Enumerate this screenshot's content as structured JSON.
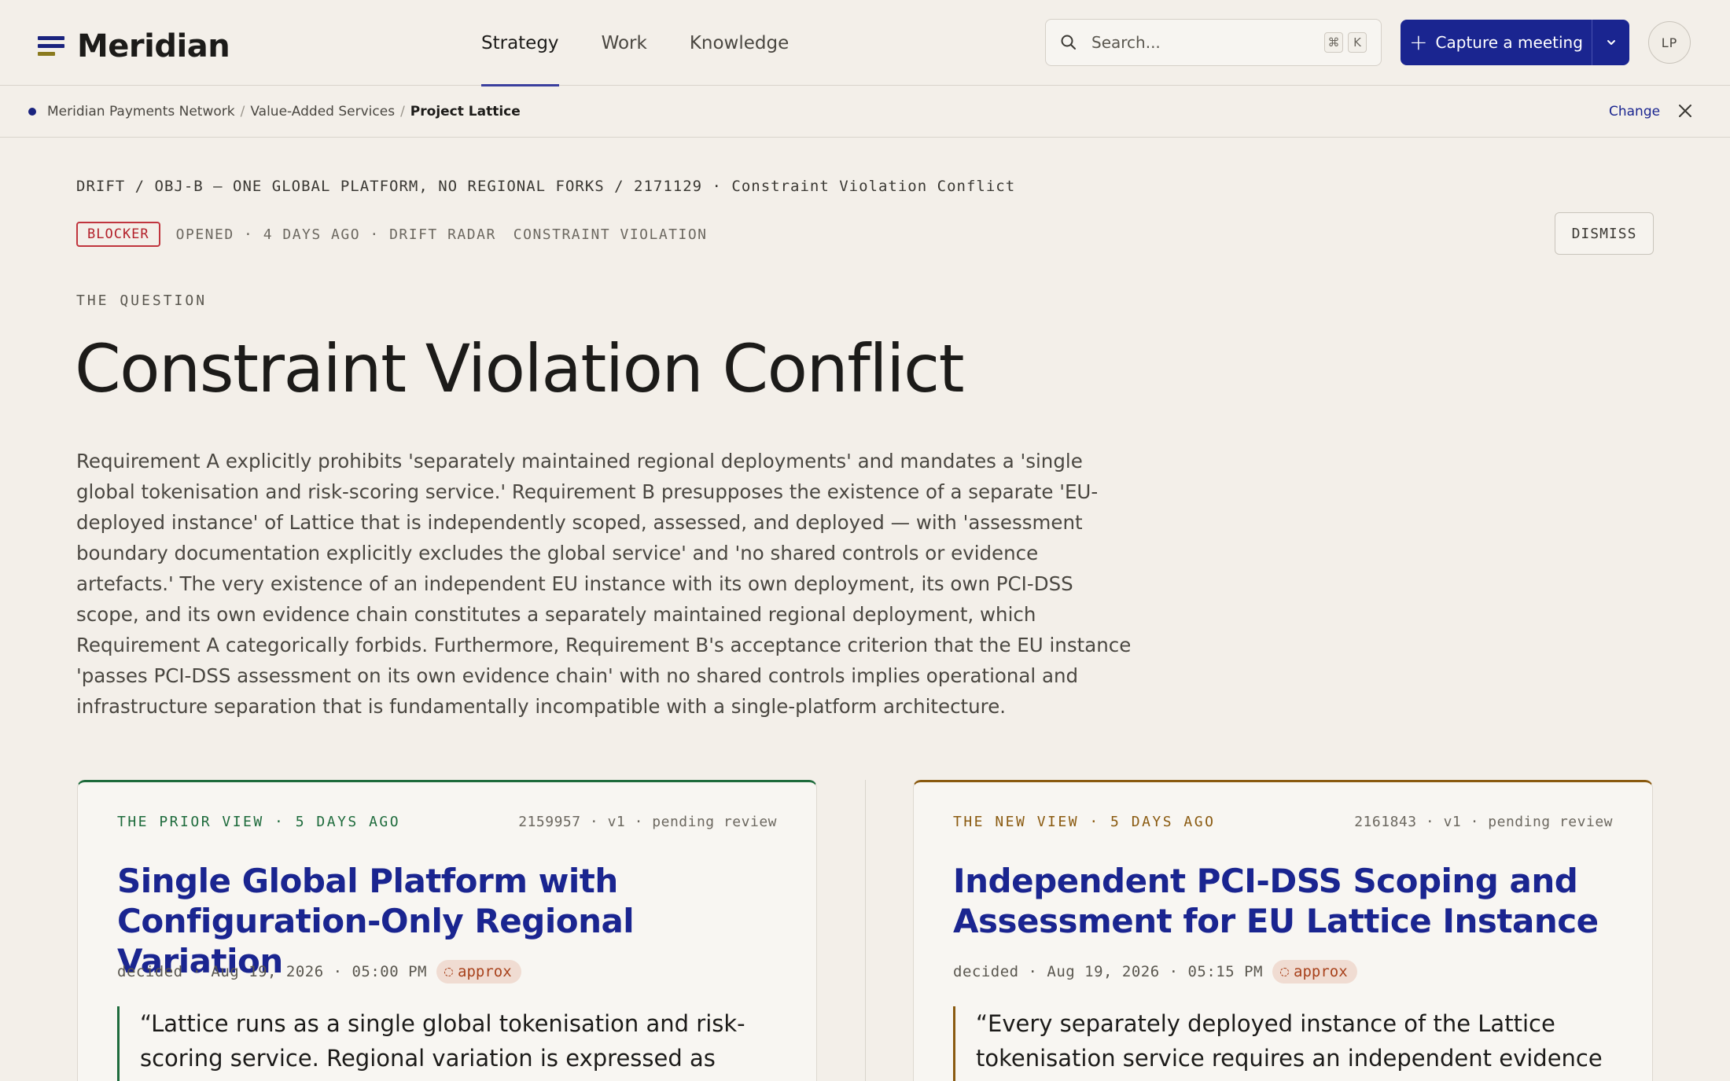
{
  "app": {
    "name": "Meridian"
  },
  "nav": {
    "items": [
      {
        "label": "Strategy",
        "active": true
      },
      {
        "label": "Work",
        "active": false
      },
      {
        "label": "Knowledge",
        "active": false
      }
    ]
  },
  "search": {
    "placeholder": "Search...",
    "shortcut_mod": "⌘",
    "shortcut_key": "K",
    "icon": "search-icon"
  },
  "capture": {
    "label": "Capture a meeting",
    "plus": "+"
  },
  "user": {
    "initials": "LP"
  },
  "context": {
    "crumbs": [
      "Meridian Payments Network",
      "Value-Added Services",
      "Project Lattice"
    ],
    "separator": "/",
    "change_label": "Change"
  },
  "drift": {
    "path": "DRIFT / OBJ-B — ONE GLOBAL PLATFORM, NO REGIONAL FORKS / 2171129 · Constraint Violation Conflict",
    "severity": "BLOCKER",
    "opened": "OPENED · 4 DAYS AGO · DRIFT RADAR",
    "type": "CONSTRAINT VIOLATION",
    "dismiss_label": "DISMISS",
    "question_label": "THE QUESTION",
    "title": "Constraint Violation Conflict",
    "description": "Requirement A explicitly prohibits 'separately maintained regional deployments' and mandates a 'single global tokenisation and risk-scoring service.' Requirement B presupposes the existence of a separate 'EU-deployed instance' of Lattice that is independently scoped, assessed, and deployed — with 'assessment boundary documentation explicitly excludes the global service' and 'no shared controls or evidence artefacts.' The very existence of an independent EU instance with its own deployment, its own PCI-DSS scope, and its own evidence chain constitutes a separately maintained regional deployment, which Requirement A categorically forbids. Furthermore, Requirement B's acceptance criterion that the EU instance 'passes PCI-DSS assessment on its own evidence chain' with no shared controls implies operational and infrastructure separation that is fundamentally incompatible with a single-platform architecture."
  },
  "prior_view": {
    "label": "THE PRIOR VIEW · 5 DAYS AGO",
    "meta": "2159957 · v1 · pending review",
    "title": "Single Global Platform with Configuration-Only Regional Variation",
    "decided": "decided · Aug 19, 2026 · 05:00 PM",
    "approx": "approx",
    "quote": "“Lattice runs as a single global tokenisation and risk-scoring service. Regional variation is expressed as configuration..."
  },
  "new_view": {
    "label": "THE NEW VIEW · 5 DAYS AGO",
    "meta": "2161843 · v1 · pending review",
    "title": "Independent PCI-DSS Scoping and Assessment for EU Lattice Instance",
    "decided": "decided · Aug 19, 2026 · 05:15 PM",
    "approx": "approx",
    "quote": "“Every separately deployed instance of the Lattice tokenisation service requires an independent evidence chain..."
  },
  "colors": {
    "accent": "#1a2590",
    "blocker": "#b3202a",
    "prior": "#1e6b3c",
    "new": "#8a5a10",
    "approx_bg": "#f0dcd2"
  }
}
